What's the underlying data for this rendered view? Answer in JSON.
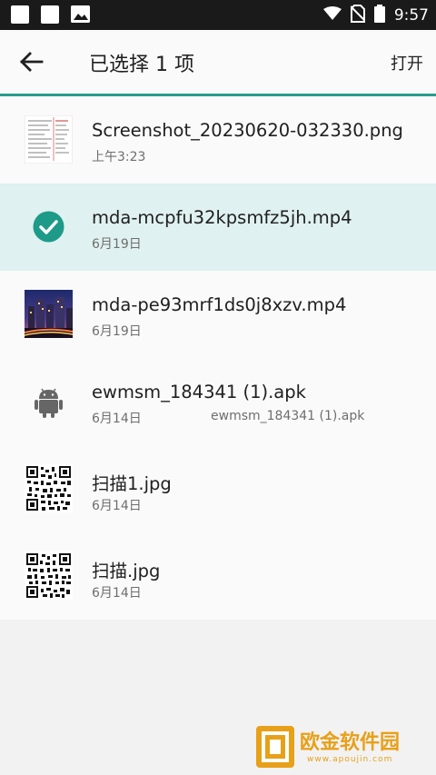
{
  "status_bar": {
    "time": "9:57"
  },
  "toolbar": {
    "title": "已选择 1 项",
    "open_label": "打开"
  },
  "files": [
    {
      "name": "Screenshot_20230620-032330.png",
      "date": "上午3:23",
      "extra": "",
      "thumb": "document-thumbnail",
      "selected": false
    },
    {
      "name": "mda-mcpfu32kpsmfz5jh.mp4",
      "date": "6月19日",
      "extra": "",
      "thumb": "check-icon",
      "selected": true
    },
    {
      "name": "mda-pe93mrf1ds0j8xzv.mp4",
      "date": "6月19日",
      "extra": "",
      "thumb": "night-city-thumbnail",
      "selected": false
    },
    {
      "name": "ewmsm_184341 (1).apk",
      "date": "6月14日",
      "extra": "ewmsm_184341 (1).apk",
      "thumb": "android-icon",
      "selected": false
    },
    {
      "name": "扫描1.jpg",
      "date": "6月14日",
      "extra": "",
      "thumb": "qr-code-thumbnail",
      "selected": false
    },
    {
      "name": "扫描.jpg",
      "date": "6月14日",
      "extra": "",
      "thumb": "qr-code-thumbnail",
      "selected": false
    }
  ],
  "watermark": {
    "text": "欧金软件园",
    "url": "www.apoujin.com"
  },
  "colors": {
    "accent": "#2a9b8d",
    "selected_bg": "#dff1f0",
    "check": "#1e9a89"
  }
}
